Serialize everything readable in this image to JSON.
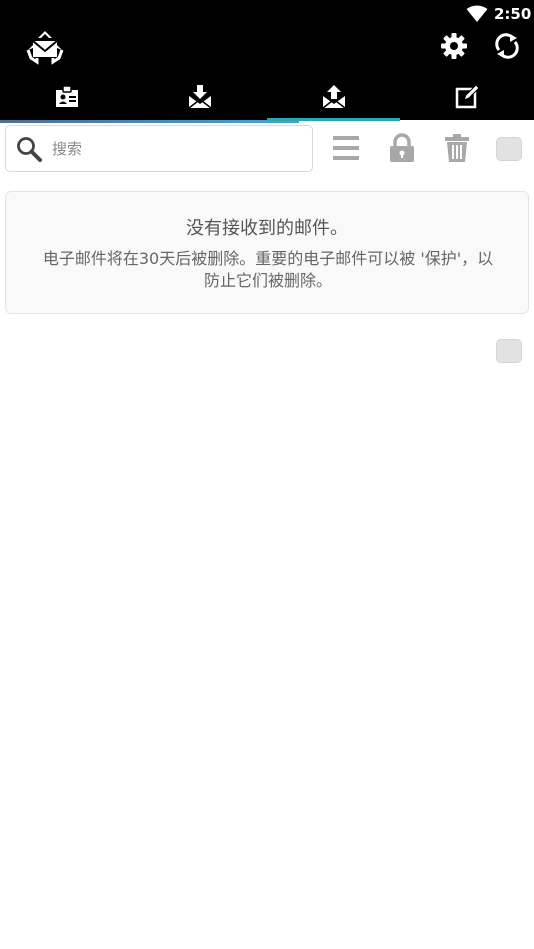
{
  "status_bar": {
    "time": "2:50",
    "wifi_icon": "wifi-icon"
  },
  "app_bar": {
    "logo_icon": "recycle-mail-logo-icon",
    "settings_icon": "gear-icon",
    "sync_icon": "sync-icon"
  },
  "tabs": [
    {
      "icon": "contact-badge-icon"
    },
    {
      "icon": "inbox-download-icon"
    },
    {
      "icon": "inbox-upload-icon",
      "selected": true
    },
    {
      "icon": "compose-icon"
    }
  ],
  "toolbar": {
    "search_placeholder": "搜索",
    "search_value": "",
    "icons": [
      "menu-icon",
      "lock-icon",
      "trash-icon"
    ]
  },
  "empty_state": {
    "title": "没有接收到的邮件。",
    "message": "电子邮件将在30天后被删除。重要的电子邮件可以被 '保护'，以防止它们被删除。"
  },
  "colors": {
    "accent": "#2aa7b7",
    "bar": "#000000",
    "icon_gray": "#a8a8a8"
  }
}
